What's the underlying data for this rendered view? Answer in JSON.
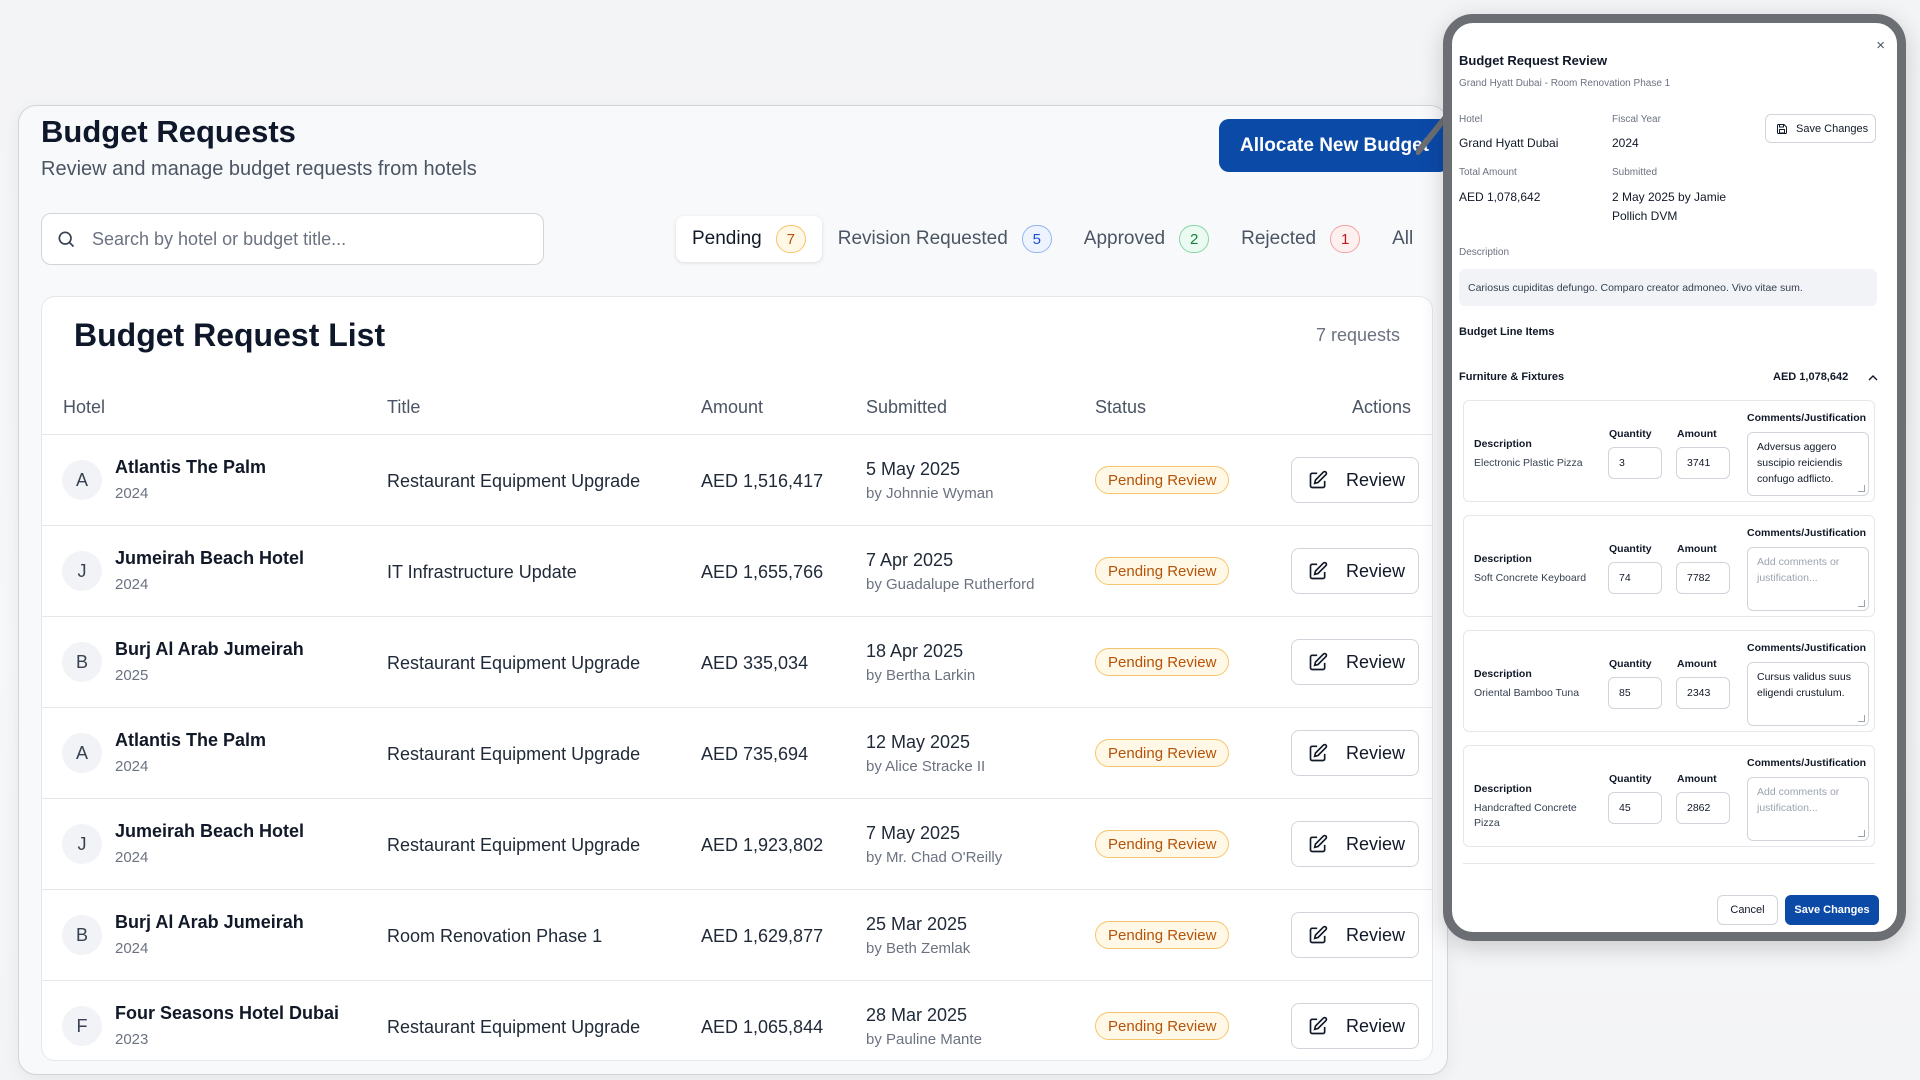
{
  "header": {
    "title": "Budget Requests",
    "subtitle": "Review and manage budget requests from hotels",
    "allocate_label": "Allocate New Budget"
  },
  "search": {
    "placeholder": "Search by hotel or budget title..."
  },
  "tabs": [
    {
      "label": "Pending",
      "count": "7"
    },
    {
      "label": "Revision Requested",
      "count": "5"
    },
    {
      "label": "Approved",
      "count": "2"
    },
    {
      "label": "Rejected",
      "count": "1"
    },
    {
      "label": "All"
    }
  ],
  "list": {
    "title": "Budget Request List",
    "count": "7 requests",
    "columns": [
      "Hotel",
      "Title",
      "Amount",
      "Submitted",
      "Status",
      "Actions"
    ],
    "review_label": "Review",
    "rows": [
      {
        "initial": "A",
        "hotel": "Atlantis The Palm",
        "year": "2024",
        "title": "Restaurant Equipment Upgrade",
        "amount": "AED 1,516,417",
        "date": "5 May 2025",
        "by": "by Johnnie Wyman",
        "status": "Pending Review"
      },
      {
        "initial": "J",
        "hotel": "Jumeirah Beach Hotel",
        "year": "2024",
        "title": "IT Infrastructure Update",
        "amount": "AED 1,655,766",
        "date": "7 Apr 2025",
        "by": "by Guadalupe Rutherford",
        "status": "Pending Review"
      },
      {
        "initial": "B",
        "hotel": "Burj Al Arab Jumeirah",
        "year": "2025",
        "title": "Restaurant Equipment Upgrade",
        "amount": "AED 335,034",
        "date": "18 Apr 2025",
        "by": "by Bertha Larkin",
        "status": "Pending Review"
      },
      {
        "initial": "A",
        "hotel": "Atlantis The Palm",
        "year": "2024",
        "title": "Restaurant Equipment Upgrade",
        "amount": "AED 735,694",
        "date": "12 May 2025",
        "by": "by Alice Stracke II",
        "status": "Pending Review"
      },
      {
        "initial": "J",
        "hotel": "Jumeirah Beach Hotel",
        "year": "2024",
        "title": "Restaurant Equipment Upgrade",
        "amount": "AED 1,923,802",
        "date": "7 May 2025",
        "by": "by Mr. Chad O'Reilly",
        "status": "Pending Review"
      },
      {
        "initial": "B",
        "hotel": "Burj Al Arab Jumeirah",
        "year": "2024",
        "title": "Room Renovation Phase 1",
        "amount": "AED 1,629,877",
        "date": "25 Mar 2025",
        "by": "by Beth Zemlak",
        "status": "Pending Review"
      },
      {
        "initial": "F",
        "hotel": "Four Seasons Hotel Dubai",
        "year": "2023",
        "title": "Restaurant Equipment Upgrade",
        "amount": "AED 1,065,844",
        "date": "28 Mar 2025",
        "by": "by Pauline Mante",
        "status": "Pending Review"
      }
    ]
  },
  "review": {
    "title": "Budget Request Review",
    "subtitle": "Grand Hyatt Dubai - Room Renovation Phase 1",
    "close": "×",
    "hotel_label": "Hotel",
    "hotel": "Grand Hyatt Dubai",
    "fiscal_label": "Fiscal Year",
    "fiscal": "2024",
    "save_top": "Save Changes",
    "total_label": "Total Amount",
    "total": "AED 1,078,642",
    "submitted_label": "Submitted",
    "submitted_line1": "2 May 2025 by Jamie",
    "submitted_line2": "Pollich DVM",
    "description_label": "Description",
    "description": "Cariosus cupiditas defungo. Comparo creator admoneo. Vivo vitae sum.",
    "line_items_label": "Budget Line Items",
    "category": "Furniture & Fixtures",
    "category_total": "AED 1,078,642",
    "col_description": "Description",
    "col_quantity": "Quantity",
    "col_amount": "Amount",
    "col_comments": "Comments/Justification",
    "comment_placeholder": "Add comments or justification...",
    "items": [
      {
        "desc": "Electronic Plastic Pizza",
        "qty": "3",
        "amount": "3741",
        "comment": "Adversus aggero suscipio reiciendis confugo adflicto."
      },
      {
        "desc": "Soft Concrete Keyboard",
        "qty": "74",
        "amount": "7782",
        "comment": ""
      },
      {
        "desc": "Oriental Bamboo Tuna",
        "qty": "85",
        "amount": "2343",
        "comment": "Cursus validus suus eligendi crustulum."
      },
      {
        "desc": "Handcrafted Concrete Pizza",
        "qty": "45",
        "amount": "2862",
        "comment": ""
      }
    ],
    "cancel": "Cancel",
    "save_bottom": "Save Changes"
  },
  "colors": {
    "primary": "#0c4aa8",
    "pending": "#b45309",
    "frame": "#6b6e73"
  }
}
